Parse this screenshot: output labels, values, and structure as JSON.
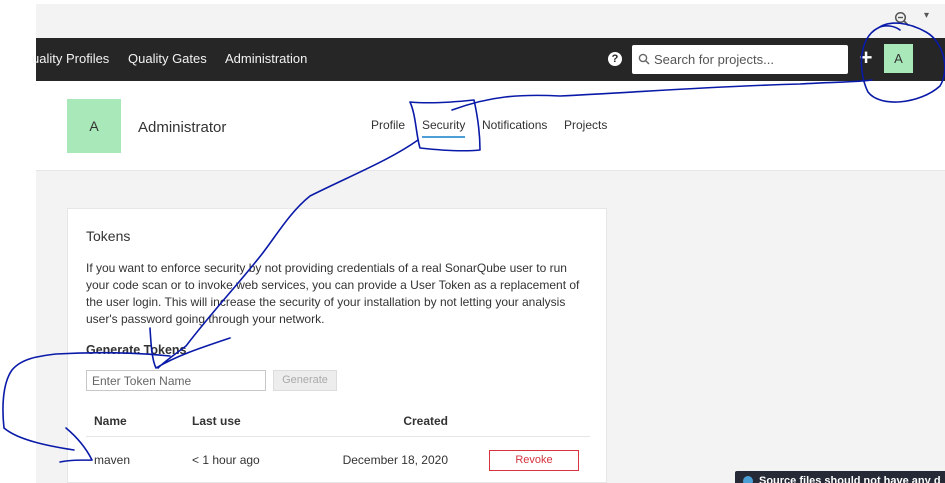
{
  "navbar": {
    "items": [
      "uality Profiles",
      "Quality Gates",
      "Administration"
    ],
    "search_placeholder": "Search for projects...",
    "avatar_letter": "A"
  },
  "account": {
    "avatar_letter": "A",
    "name": "Administrator",
    "tabs": [
      "Profile",
      "Security",
      "Notifications",
      "Projects"
    ],
    "active_tab": "Security"
  },
  "tokens": {
    "title": "Tokens",
    "description": "If you want to enforce security by not providing credentials of a real SonarQube user to run your code scan or to invoke web services, you can provide a User Token as a replacement of the user login. This will increase the security of your installation by not letting your analysis user's password going through your network.",
    "generate_title": "Generate Tokens",
    "input_placeholder": "Enter Token Name",
    "generate_label": "Generate",
    "columns": [
      "Name",
      "Last use",
      "Created"
    ],
    "rows": [
      {
        "name": "maven",
        "last_use": "< 1 hour ago",
        "created": "December 18, 2020",
        "action": "Revoke"
      }
    ]
  },
  "notice": {
    "text": "Source files should not have any d"
  },
  "colors": {
    "navbar_bg": "#262626",
    "avatar_green": "#a9e9b9",
    "active_tab_underline": "#4b9fd5",
    "revoke_red": "#d4333f",
    "annotation_ink": "#0a1aa8"
  }
}
